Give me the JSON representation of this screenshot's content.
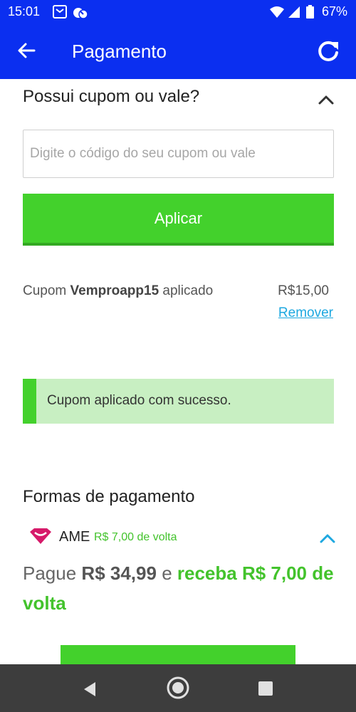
{
  "status_bar": {
    "time": "15:01",
    "battery": "67%",
    "icons": [
      "notification-icon",
      "sync-icon",
      "wifi-icon",
      "signal-icon",
      "battery-icon"
    ]
  },
  "app_bar": {
    "title": "Pagamento",
    "back_icon": "arrow-back-icon",
    "refresh_icon": "refresh-icon",
    "color": "#0b2ff0"
  },
  "coupon": {
    "title": "Possui cupom ou vale?",
    "placeholder": "Digite o código do seu cupom ou vale",
    "apply_label": "Aplicar",
    "applied_prefix": "Cupom",
    "applied_code": "Vemproapp15",
    "applied_suffix": "aplicado",
    "applied_value": "R$15,00",
    "remove_label": "Remover",
    "success_message": "Cupom aplicado com sucesso."
  },
  "payment": {
    "title": "Formas de pagamento",
    "method_name": "AME",
    "cashback_label": "R$ 7,00 de volta",
    "line_prefix": "Pague",
    "line_amount": "R$ 34,99",
    "line_connector": "e",
    "line_highlight": "receba R$ 7,00 de volta"
  },
  "colors": {
    "accent_green": "#43d12c",
    "link_blue": "#1ea8e0",
    "ame_pink": "#d61a6a"
  }
}
